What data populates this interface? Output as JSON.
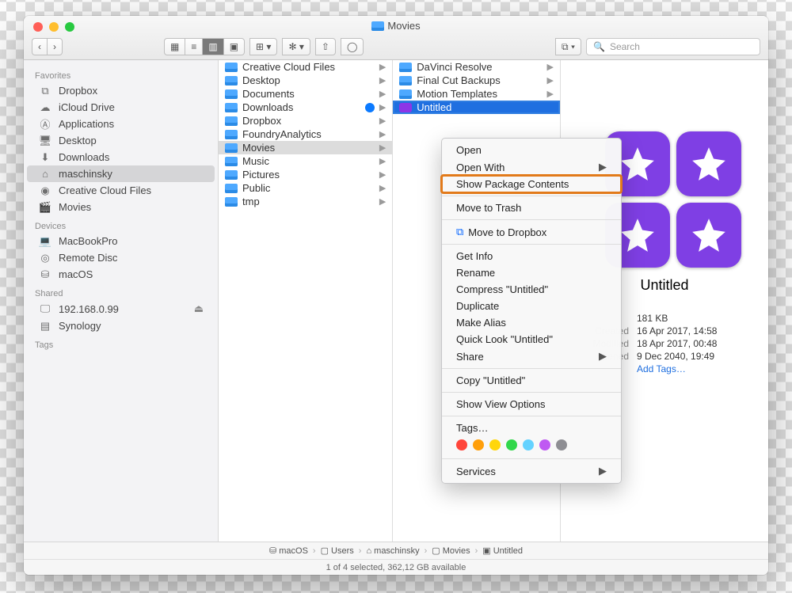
{
  "window": {
    "title": "Movies"
  },
  "toolbar": {
    "search_placeholder": "Search"
  },
  "sidebar": {
    "sections": [
      {
        "header": "Favorites",
        "items": [
          {
            "icon": "dropbox",
            "label": "Dropbox"
          },
          {
            "icon": "cloud",
            "label": "iCloud Drive"
          },
          {
            "icon": "apps",
            "label": "Applications"
          },
          {
            "icon": "desktop",
            "label": "Desktop"
          },
          {
            "icon": "downloads",
            "label": "Downloads"
          },
          {
            "icon": "home",
            "label": "maschinsky",
            "selected": true
          },
          {
            "icon": "cc",
            "label": "Creative Cloud Files"
          },
          {
            "icon": "movies",
            "label": "Movies"
          }
        ]
      },
      {
        "header": "Devices",
        "items": [
          {
            "icon": "laptop",
            "label": "MacBookPro"
          },
          {
            "icon": "disc",
            "label": "Remote Disc"
          },
          {
            "icon": "disk",
            "label": "macOS"
          }
        ]
      },
      {
        "header": "Shared",
        "items": [
          {
            "icon": "screen",
            "label": "192.168.0.99",
            "eject": true
          },
          {
            "icon": "nas",
            "label": "Synology"
          }
        ]
      },
      {
        "header": "Tags",
        "items": []
      }
    ]
  },
  "col1": [
    {
      "label": "Creative Cloud Files",
      "arrow": true
    },
    {
      "label": "Desktop",
      "arrow": true
    },
    {
      "label": "Documents",
      "arrow": true
    },
    {
      "label": "Downloads",
      "arrow": true,
      "sync": true
    },
    {
      "label": "Dropbox",
      "arrow": true
    },
    {
      "label": "FoundryAnalytics",
      "arrow": true
    },
    {
      "label": "Movies",
      "arrow": true,
      "selected": true
    },
    {
      "label": "Music",
      "arrow": true
    },
    {
      "label": "Pictures",
      "arrow": true
    },
    {
      "label": "Public",
      "arrow": true
    },
    {
      "label": "tmp",
      "arrow": true
    }
  ],
  "col2": [
    {
      "label": "DaVinci Resolve",
      "arrow": true
    },
    {
      "label": "Final Cut Backups",
      "arrow": true
    },
    {
      "label": "Motion Templates",
      "arrow": true
    },
    {
      "label": "Untitled",
      "arrow": false,
      "selected": true,
      "purple": true,
      "editing": true
    }
  ],
  "context_menu": {
    "groups": [
      [
        {
          "label": "Open"
        },
        {
          "label": "Open With",
          "submenu": true
        },
        {
          "label": "Show Package Contents",
          "highlight": true
        }
      ],
      [
        {
          "label": "Move to Trash"
        }
      ],
      [
        {
          "label": "Move to Dropbox",
          "icon": "dropbox"
        }
      ],
      [
        {
          "label": "Get Info"
        },
        {
          "label": "Rename"
        },
        {
          "label": "Compress \"Untitled\""
        },
        {
          "label": "Duplicate"
        },
        {
          "label": "Make Alias"
        },
        {
          "label": "Quick Look \"Untitled\""
        },
        {
          "label": "Share",
          "submenu": true
        }
      ],
      [
        {
          "label": "Copy \"Untitled\""
        }
      ],
      [
        {
          "label": "Show View Options"
        }
      ],
      [
        {
          "label": "Tags…",
          "tags": true
        }
      ],
      [
        {
          "label": "Services",
          "submenu": true
        }
      ]
    ],
    "tag_colors": [
      "#ff453a",
      "#ff9f0a",
      "#ffd60a",
      "#32d74b",
      "#64d2ff",
      "#bf5af2",
      "#8e8e93"
    ]
  },
  "preview": {
    "title": "Untitled",
    "meta": [
      {
        "k": "",
        "v": "181 KB"
      },
      {
        "k": "Created",
        "v": "16 Apr 2017, 14:58"
      },
      {
        "k": "Modified",
        "v": "18 Apr 2017, 00:48"
      },
      {
        "k": "opened",
        "v": "9 Dec 2040, 19:49"
      }
    ],
    "add_tags": "Add Tags…"
  },
  "pathbar": [
    "macOS",
    "Users",
    "maschinsky",
    "Movies",
    "Untitled"
  ],
  "status": "1 of 4 selected, 362,12 GB available"
}
